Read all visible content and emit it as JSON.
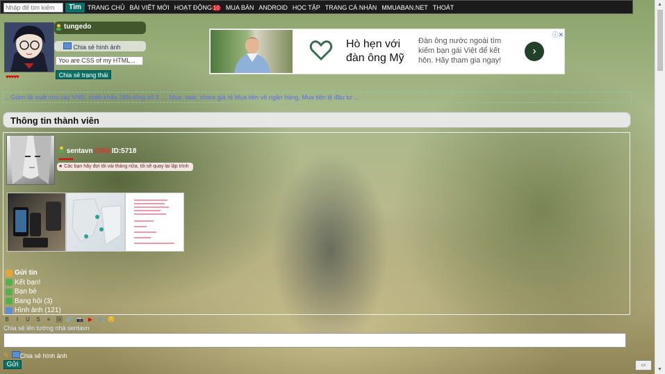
{
  "topbar": {
    "search_placeholder": "Nhập để tìm kiếm",
    "search_button": "Tìm",
    "nav": [
      {
        "label": "TRANG CHỦ"
      },
      {
        "label": "BÀI VIẾT MỚI"
      },
      {
        "label": "HOẠT ĐỘNG",
        "badge": "10"
      },
      {
        "label": "MUA BÁN"
      },
      {
        "label": "ANDROID"
      },
      {
        "label": "HỌC TẬP"
      },
      {
        "label": "TRANG CÁ NHÂN"
      },
      {
        "label": "MMUABAN.NET"
      },
      {
        "label": "THOÁT"
      }
    ]
  },
  "profile": {
    "username": "tungedo",
    "share_image": "Chia sẻ hình ảnh",
    "status_value": "You are CSS of my HTML...",
    "status_button": "Chia sẻ trạng thái"
  },
  "ad": {
    "title": "Hò hẹn với đàn ông Mỹ",
    "description": "Đàn ông nước ngoài tìm kiếm bạn gái Việt để kết hôn. Hãy tham gia ngay!"
  },
  "marquee": "... Giảm lãi suất cho vay VNĐ, chiết khấu 16%.tổng số 3 .... Mua, sale, share giá rẻ Mua tiền về ngân hàng, Mua tiền lệ đầu tư ...",
  "member": {
    "panel_title": "Thông tin thành viên",
    "name": "sentavn",
    "online": "(ON)",
    "id": "ID:5718",
    "status": "Các bạn hãy đợi tôi vài tháng nữa, tôi sẽ quay lại lập trình",
    "links": [
      {
        "label": "Gửi tin",
        "bold": true,
        "color": "#e8a33a"
      },
      {
        "label": "Kết bạn!",
        "color": "#55b04a"
      },
      {
        "label": "Bạn bè",
        "color": "#55b04a"
      },
      {
        "label": "Bang hội (3)",
        "color": "#55b04a"
      },
      {
        "label": "Hình ảnh (121)",
        "color": "#5b8fd1"
      }
    ]
  },
  "editor": {
    "toolbar": [
      "B",
      "I",
      "U",
      "S",
      "≡",
      "🖼",
      "🔗",
      "📷",
      "▶",
      "📎",
      "😊"
    ],
    "share_label": "Chia sẻ lên tường nhà sentavn",
    "bottom_share_image": "Chia sẻ hình ảnh",
    "send_button": "Gửi"
  },
  "colors": {
    "accent": "#0b6f66",
    "topbar": "#1b1b1b",
    "online": "#e03030"
  }
}
